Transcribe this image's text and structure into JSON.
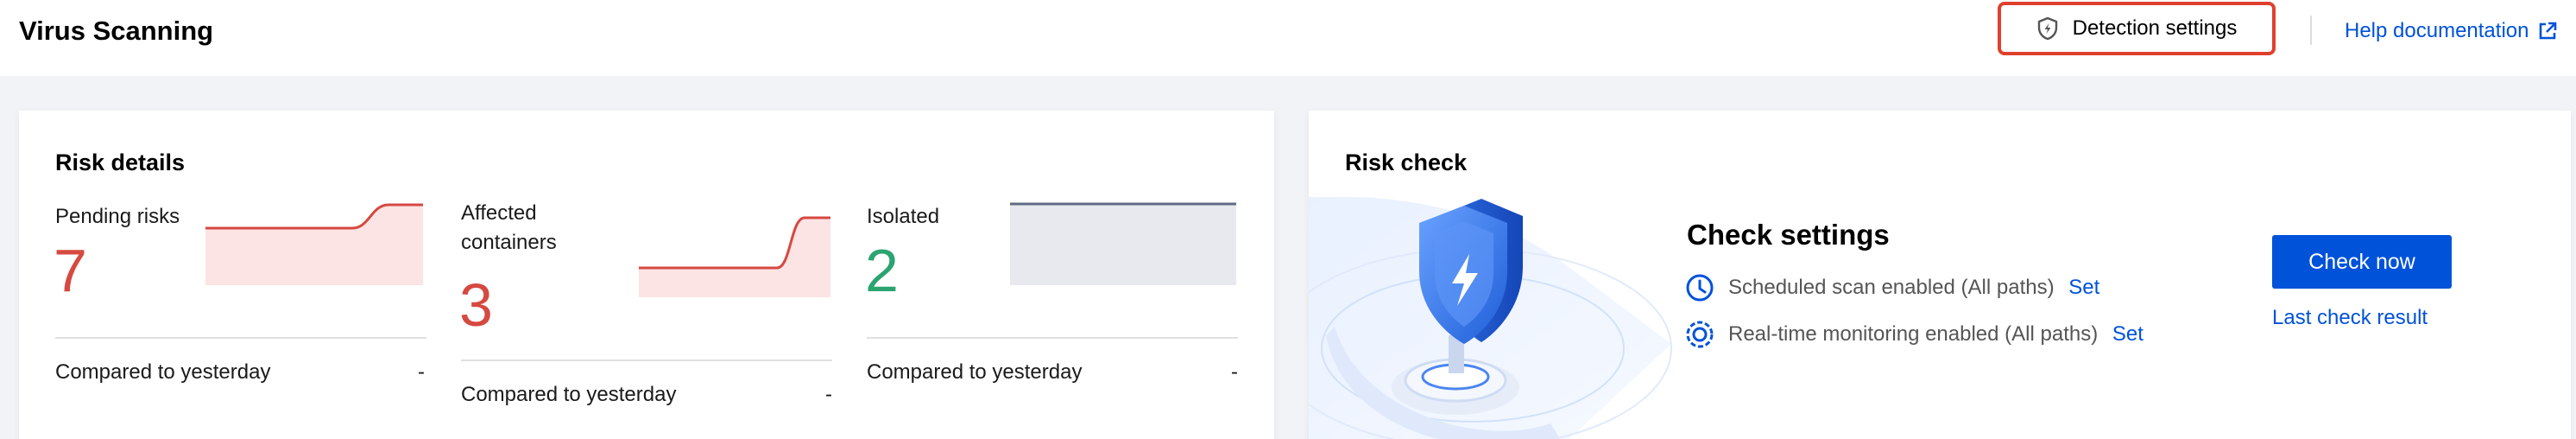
{
  "header": {
    "title": "Virus Scanning",
    "detection_settings_label": "Detection settings",
    "detection_settings_icon": "shield-icon",
    "help_label": "Help documentation",
    "help_icon": "external-link-icon"
  },
  "risk_details": {
    "title": "Risk details",
    "metrics": [
      {
        "label": "Pending risks",
        "value": "7",
        "compare_label": "Compared to yesterday",
        "compare_value": "-"
      },
      {
        "label": "Affected containers",
        "value": "3",
        "compare_label": "Compared to yesterday",
        "compare_value": "-"
      },
      {
        "label": "Isolated",
        "value": "2",
        "compare_label": "Compared to yesterday",
        "compare_value": "-"
      }
    ]
  },
  "risk_check": {
    "title": "Risk check",
    "settings_title": "Check settings",
    "scheduled_text": "Scheduled scan enabled (All paths)",
    "scheduled_set": "Set",
    "realtime_text": "Real-time monitoring enabled (All paths)",
    "realtime_set": "Set",
    "check_now_label": "Check now",
    "last_result_label": "Last check result"
  },
  "colors": {
    "accent": "#0052d9",
    "risk_red": "#d54941",
    "safe_green": "#2ba471",
    "highlight_border": "#e0402e"
  }
}
